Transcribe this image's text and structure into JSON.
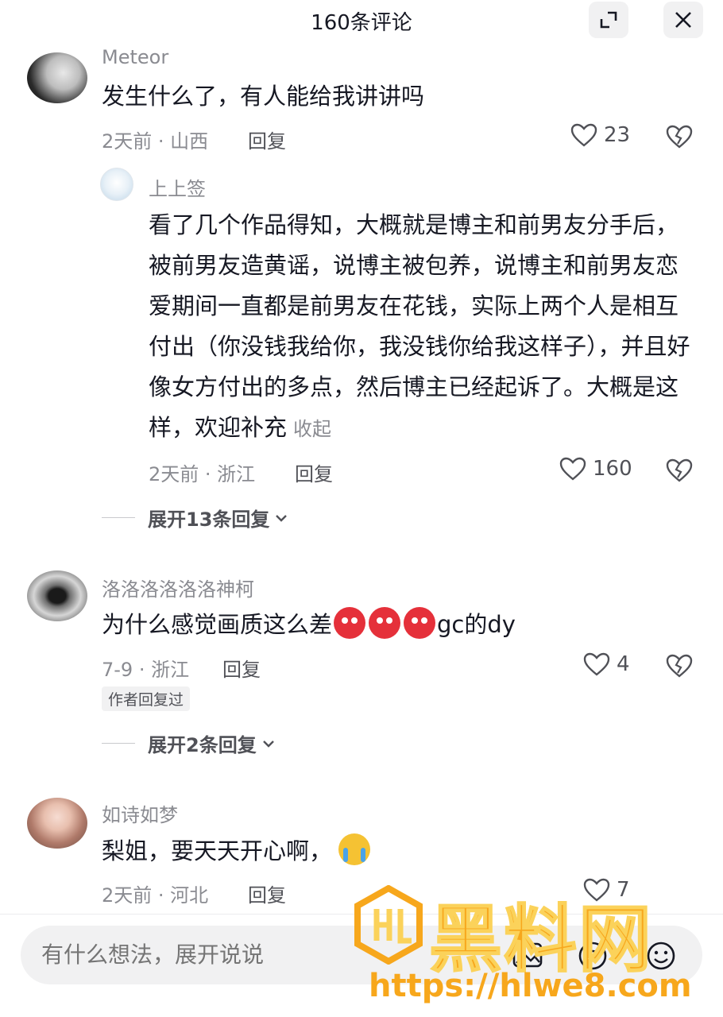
{
  "header": {
    "title": "160条评论"
  },
  "comments": [
    {
      "username": "Meteor",
      "text": "发生什么了，有人能给我讲讲吗",
      "meta": "2天前 · 山西",
      "reply": "回复",
      "likes": "23",
      "replies": [
        {
          "username": "上上签",
          "text": "看了几个作品得知，大概就是博主和前男友分手后，被前男友造黄谣，说博主被包养，说博主和前男友恋爱期间一直都是前男友在花钱，实际上两个人是相互付出（你没钱我给你，我没钱你给我这样子），并且好像女方付出的多点，然后博主已经起诉了。大概是这样，欢迎补充",
          "collapse": "收起",
          "meta": "2天前 · 浙江",
          "reply": "回复",
          "likes": "160"
        }
      ],
      "expand": "展开13条回复"
    },
    {
      "username": "洛洛洛洛洛洛神柯",
      "text": "为什么感觉画质这么差",
      "text_suffix": "gc的dy",
      "meta": "7-9 · 浙江",
      "reply": "回复",
      "likes": "4",
      "badge": "作者回复过",
      "expand": "展开2条回复"
    },
    {
      "username": "如诗如梦",
      "text": "梨姐，要天天开心啊，",
      "meta": "2天前 · 河北",
      "reply": "回复",
      "likes": "7"
    }
  ],
  "input": {
    "placeholder": "有什么想法，展开说说"
  },
  "watermark": {
    "title": "黑料网",
    "url": "https://hlwe8.com"
  },
  "colors": {
    "accent": "#f7a71c",
    "text": "#161823",
    "muted": "#8a8b91"
  }
}
